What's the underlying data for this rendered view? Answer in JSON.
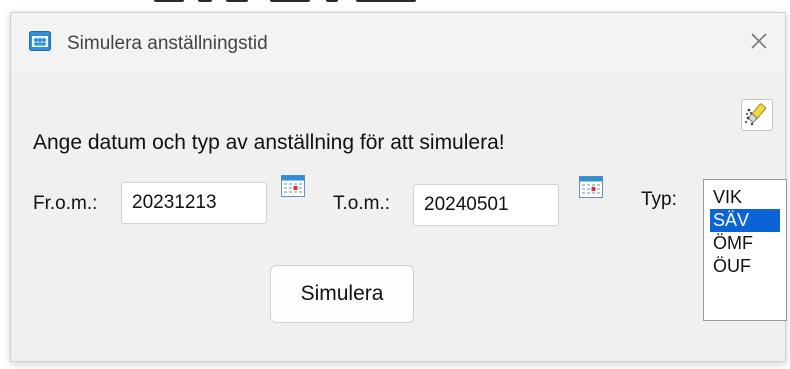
{
  "window": {
    "title": "Simulera anställningstid",
    "close_glyph": "✕",
    "app_icon": "people-window-icon"
  },
  "toolbar": {
    "clear_icon": "eraser-icon"
  },
  "form": {
    "instruction": "Ange datum och typ av anställning för att simulera!",
    "from_label": "Fr.o.m.:",
    "from_value": "20231213",
    "to_label": "T.o.m.:",
    "to_value": "20240501",
    "calendar_icon": "calendar-icon",
    "type_label": "Typ:",
    "type_options": [
      "VIK",
      "SÄV",
      "ÖMF",
      "ÖUF"
    ],
    "type_selected": "SÄV",
    "submit_label": "Simulera"
  },
  "colors": {
    "window_bg": "#f0f0f0",
    "selection": "#0a64d6",
    "icon_blue": "#2f8fd6"
  }
}
